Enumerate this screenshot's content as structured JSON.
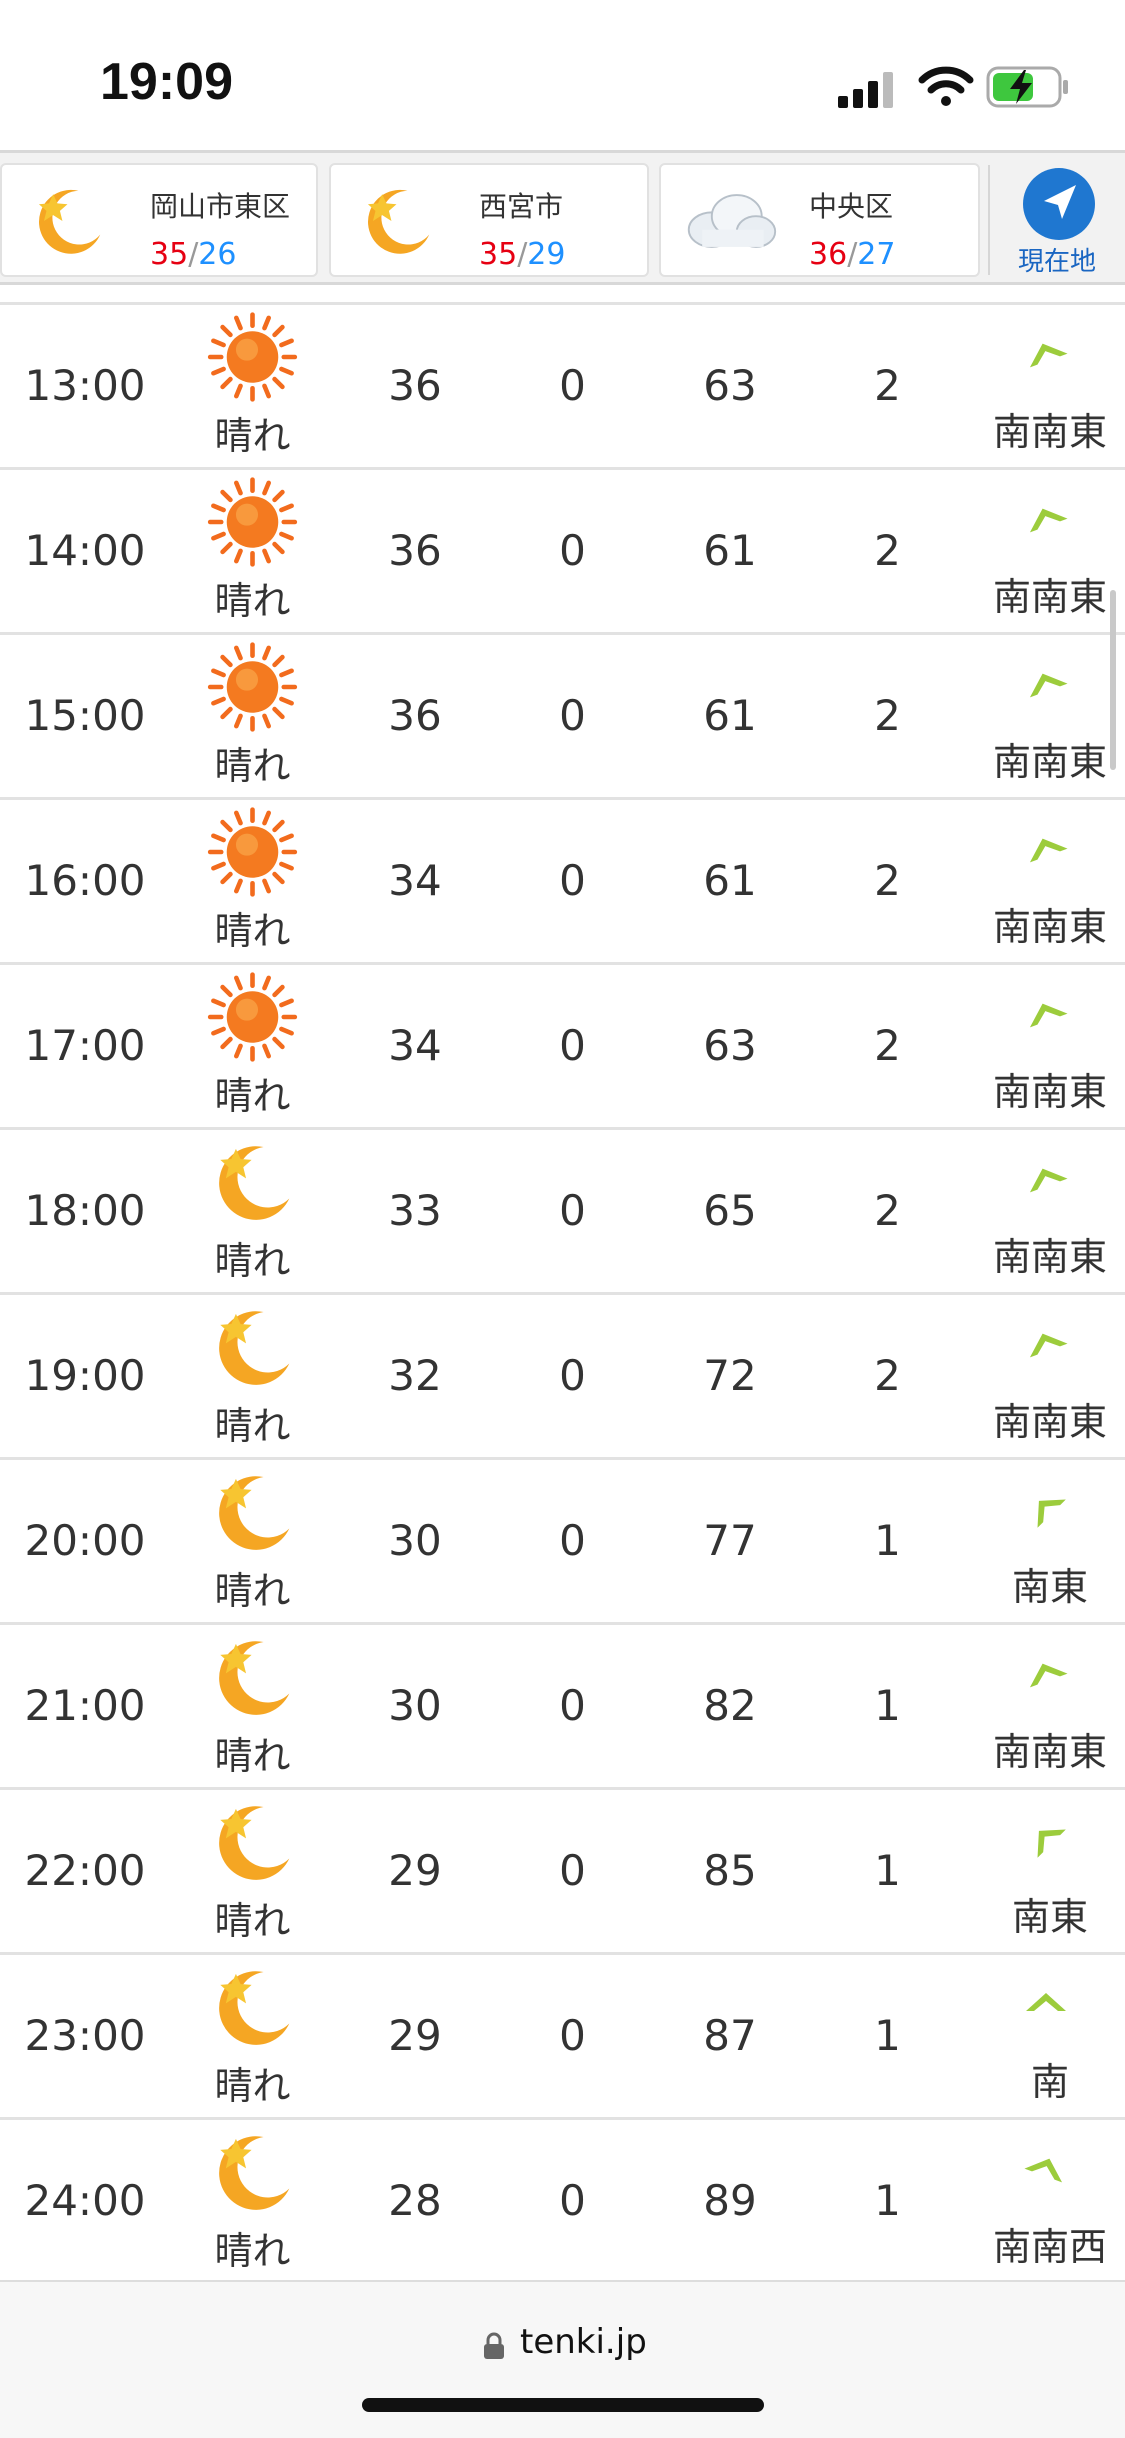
{
  "status": {
    "time": "19:09"
  },
  "locations": [
    {
      "name": "岡山市東区",
      "high": "35",
      "low": "26",
      "icon": "moon-icon"
    },
    {
      "name": "西宮市",
      "high": "35",
      "low": "29",
      "icon": "moon-icon"
    },
    {
      "name": "中央区",
      "high": "36",
      "low": "27",
      "icon": "cloud-icon"
    }
  ],
  "temp_separator": "/",
  "current_location_label": "現在地",
  "rows": [
    {
      "time": "13:00",
      "weather": "晴れ",
      "icon": "sun-icon",
      "temp": "36",
      "precip": "0",
      "humidity": "63",
      "wind": "2",
      "direction": "南南東"
    },
    {
      "time": "14:00",
      "weather": "晴れ",
      "icon": "sun-icon",
      "temp": "36",
      "precip": "0",
      "humidity": "61",
      "wind": "2",
      "direction": "南南東"
    },
    {
      "time": "15:00",
      "weather": "晴れ",
      "icon": "sun-icon",
      "temp": "36",
      "precip": "0",
      "humidity": "61",
      "wind": "2",
      "direction": "南南東"
    },
    {
      "time": "16:00",
      "weather": "晴れ",
      "icon": "sun-icon",
      "temp": "34",
      "precip": "0",
      "humidity": "61",
      "wind": "2",
      "direction": "南南東"
    },
    {
      "time": "17:00",
      "weather": "晴れ",
      "icon": "sun-icon",
      "temp": "34",
      "precip": "0",
      "humidity": "63",
      "wind": "2",
      "direction": "南南東"
    },
    {
      "time": "18:00",
      "weather": "晴れ",
      "icon": "moon-icon",
      "temp": "33",
      "precip": "0",
      "humidity": "65",
      "wind": "2",
      "direction": "南南東"
    },
    {
      "time": "19:00",
      "weather": "晴れ",
      "icon": "moon-icon",
      "temp": "32",
      "precip": "0",
      "humidity": "72",
      "wind": "2",
      "direction": "南南東"
    },
    {
      "time": "20:00",
      "weather": "晴れ",
      "icon": "moon-icon",
      "temp": "30",
      "precip": "0",
      "humidity": "77",
      "wind": "1",
      "direction": "南東"
    },
    {
      "time": "21:00",
      "weather": "晴れ",
      "icon": "moon-icon",
      "temp": "30",
      "precip": "0",
      "humidity": "82",
      "wind": "1",
      "direction": "南南東"
    },
    {
      "time": "22:00",
      "weather": "晴れ",
      "icon": "moon-icon",
      "temp": "29",
      "precip": "0",
      "humidity": "85",
      "wind": "1",
      "direction": "南東"
    },
    {
      "time": "23:00",
      "weather": "晴れ",
      "icon": "moon-icon",
      "temp": "29",
      "precip": "0",
      "humidity": "87",
      "wind": "1",
      "direction": "南"
    },
    {
      "time": "24:00",
      "weather": "晴れ",
      "icon": "moon-icon",
      "temp": "28",
      "precip": "0",
      "humidity": "89",
      "wind": "1",
      "direction": "南南西"
    }
  ],
  "browser": {
    "url": "tenki.jp"
  },
  "colors": {
    "high_temp": "#e60012",
    "low_temp": "#1e90ff",
    "wind_arrow": "#9ccc3c",
    "current_location": "#1a66c2"
  }
}
